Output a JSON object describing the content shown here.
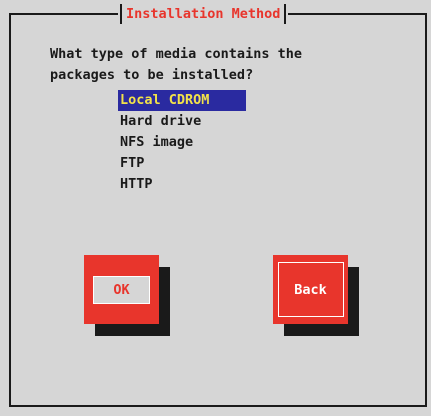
{
  "dialog": {
    "title": "Installation Method",
    "question": "What type of media contains the\npackages to be installed?",
    "options": [
      {
        "label": "Local CDROM",
        "selected": true
      },
      {
        "label": "Hard drive",
        "selected": false
      },
      {
        "label": "NFS image",
        "selected": false
      },
      {
        "label": "FTP",
        "selected": false
      },
      {
        "label": "HTTP",
        "selected": false
      }
    ],
    "buttons": {
      "ok_label": "OK",
      "back_label": "Back"
    }
  },
  "colors": {
    "background": "#d6d6d6",
    "accent_red": "#e8352c",
    "selection_bg": "#2a2aa0",
    "selection_fg": "#f2e24a",
    "text": "#1a1a1a"
  }
}
